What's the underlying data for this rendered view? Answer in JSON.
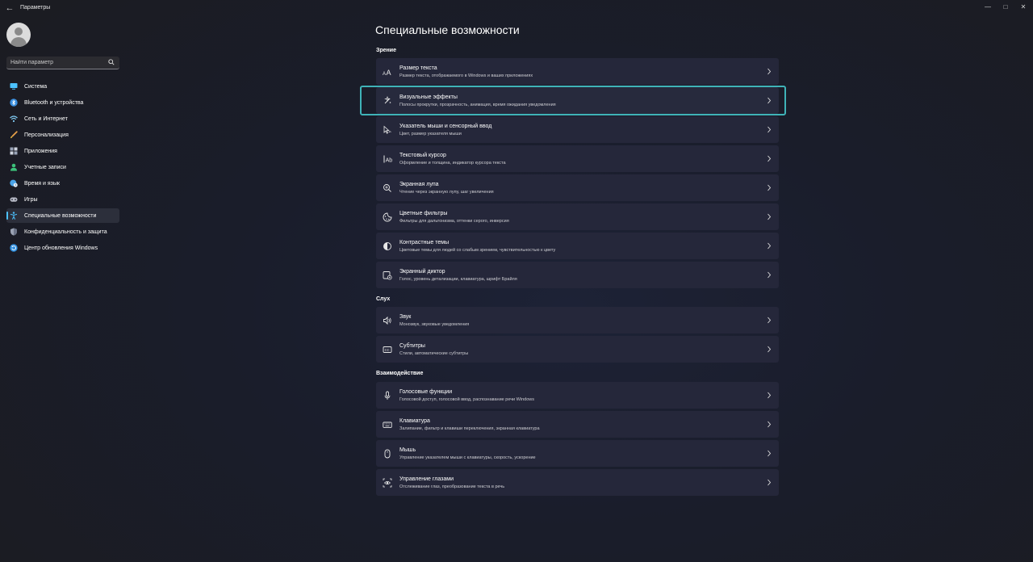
{
  "window": {
    "title": "Параметры",
    "back_icon": "←",
    "minimize_icon": "—",
    "maximize_icon": "□",
    "close_icon": "✕"
  },
  "sidebar": {
    "search_placeholder": "Найти параметр",
    "items": [
      {
        "label": "Система",
        "icon": "monitor-icon",
        "color": "#4cc2ff"
      },
      {
        "label": "Bluetooth и устройства",
        "icon": "bluetooth-icon",
        "color": "#3a8fe0"
      },
      {
        "label": "Сеть и Интернет",
        "icon": "wifi-icon",
        "color": "#7fc8f0"
      },
      {
        "label": "Персонализация",
        "icon": "brush-icon",
        "color": "#e8a04a"
      },
      {
        "label": "Приложения",
        "icon": "apps-icon",
        "color": "#9aa4b8"
      },
      {
        "label": "Учетные записи",
        "icon": "person-icon",
        "color": "#3cc17a"
      },
      {
        "label": "Время и язык",
        "icon": "globe-clock-icon",
        "color": "#4aa3e8"
      },
      {
        "label": "Игры",
        "icon": "gamepad-icon",
        "color": "#b9bcc8"
      },
      {
        "label": "Специальные возможности",
        "icon": "accessibility-icon",
        "color": "#4cc2ff"
      },
      {
        "label": "Конфиденциальность и защита",
        "icon": "shield-icon",
        "color": "#9ba3b4"
      },
      {
        "label": "Центр обновления Windows",
        "icon": "update-icon",
        "color": "#2f8fe0"
      }
    ],
    "active_index": 8
  },
  "main": {
    "title": "Специальные возможности",
    "sections": [
      {
        "title": "Зрение",
        "items": [
          {
            "title": "Размер текста",
            "desc": "Размер текста, отображаемого в Windows и ваших приложениях",
            "icon": "text-size-icon"
          },
          {
            "title": "Визуальные эффекты",
            "desc": "Полосы прокрутки, прозрачность, анимация, время ожидания уведомления",
            "icon": "sparkle-icon"
          },
          {
            "title": "Указатель мыши и сенсорный ввод",
            "desc": "Цвет, размер указателя мыши",
            "icon": "pointer-icon"
          },
          {
            "title": "Текстовый курсор",
            "desc": "Оформление и толщина, индикатор курсора текста",
            "icon": "text-cursor-icon"
          },
          {
            "title": "Экранная лупа",
            "desc": "Чтение через экранную лупу, шаг увеличения",
            "icon": "magnifier-icon"
          },
          {
            "title": "Цветные фильтры",
            "desc": "Фильтры для дальтонизма, оттенки серого, инверсия",
            "icon": "color-filter-icon"
          },
          {
            "title": "Контрастные темы",
            "desc": "Цветовые темы для людей со слабым зрением, чувствительностью к цвету",
            "icon": "contrast-icon"
          },
          {
            "title": "Экранный диктор",
            "desc": "Голос, уровень детализации, клавиатура, шрифт Брайля",
            "icon": "narrator-icon"
          }
        ]
      },
      {
        "title": "Слух",
        "items": [
          {
            "title": "Звук",
            "desc": "Монозвук, звуковые уведомления",
            "icon": "speaker-icon"
          },
          {
            "title": "Субтитры",
            "desc": "Стили, автоматические субтитры",
            "icon": "captions-icon"
          }
        ]
      },
      {
        "title": "Взаимодействие",
        "items": [
          {
            "title": "Голосовые функции",
            "desc": "Голосовой доступ, голосовой ввод, распознавание речи Windows",
            "icon": "microphone-icon"
          },
          {
            "title": "Клавиатура",
            "desc": "Залипание, фильтр и клавиши переключения, экранная клавиатура",
            "icon": "keyboard-icon"
          },
          {
            "title": "Мышь",
            "desc": "Управление указателем мыши с клавиатуры, скорость, ускорение",
            "icon": "mouse-icon"
          },
          {
            "title": "Управление глазами",
            "desc": "Отслеживание глаз, преобразование текста в речь",
            "icon": "eye-control-icon"
          }
        ]
      }
    ],
    "focused_item": "Визуальные эффекты"
  }
}
